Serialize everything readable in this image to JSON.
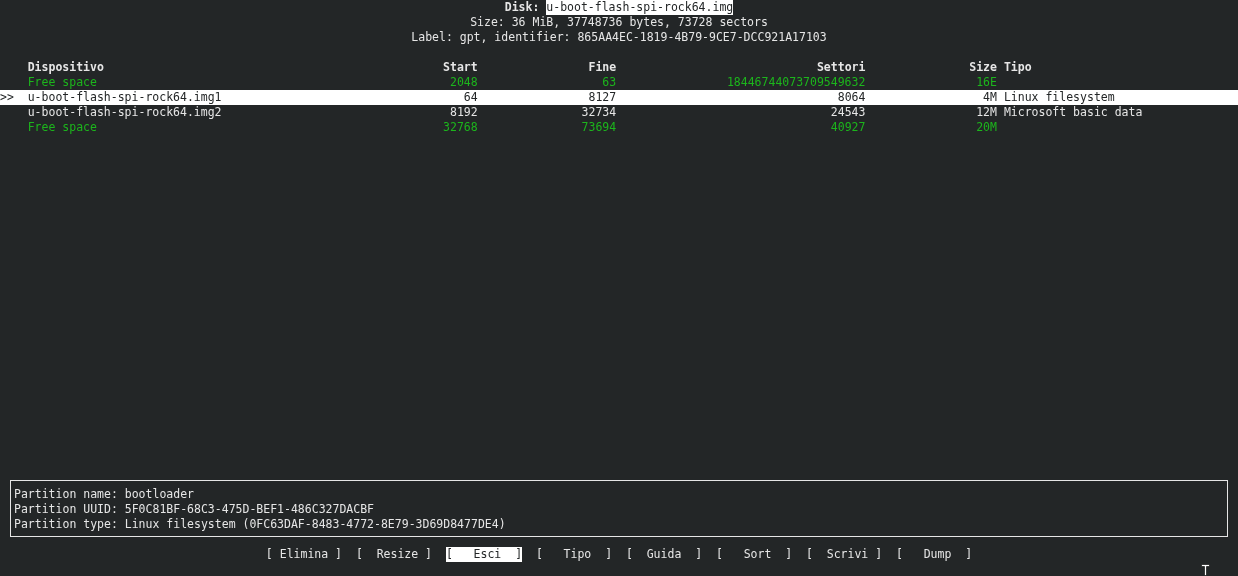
{
  "header": {
    "disk_label": "Disk:",
    "disk_name": "u-boot-flash-spi-rock64.img",
    "size_line": "Size: 36 MiB, 37748736 bytes, 73728 sectors",
    "label_line": "Label: gpt, identifier: 865AA4EC-1819-4B79-9CE7-DCC921A17103"
  },
  "table": {
    "cursor": ">>",
    "columns": [
      "Dispositivo",
      "Start",
      "Fine",
      "Settori",
      "Size",
      "Tipo"
    ],
    "rows": [
      {
        "kind": "free",
        "selected": false,
        "device": "Free space",
        "start": "2048",
        "end": "63",
        "sectors": "18446744073709549632",
        "size": "16E"
      },
      {
        "kind": "partition",
        "selected": true,
        "device": "u-boot-flash-spi-rock64.img1",
        "start": "64",
        "end": "8127",
        "sectors": "8064",
        "size": "4M",
        "type": "Linux filesystem"
      },
      {
        "kind": "partition",
        "selected": false,
        "device": "u-boot-flash-spi-rock64.img2",
        "start": "8192",
        "end": "32734",
        "sectors": "24543",
        "size": "12M",
        "type": "Microsoft basic data"
      },
      {
        "kind": "free",
        "selected": false,
        "device": "Free space",
        "start": "32768",
        "end": "73694",
        "sectors": "40927",
        "size": "20M"
      }
    ]
  },
  "info": [
    "Partition name: bootloader",
    "Partition UUID: 5F0C81BF-68C3-475D-BEF1-486C327DACBF",
    "Partition type: Linux filesystem (0FC63DAF-8483-4772-8E79-3D69D8477DE4)"
  ],
  "buttons": [
    {
      "text": "[ Elimina ]",
      "selected": false
    },
    {
      "text": "[  Resize ]",
      "selected": false
    },
    {
      "text": "[   Esci  ]",
      "selected": true
    },
    {
      "text": "[   Tipo  ]",
      "selected": false
    },
    {
      "text": "[  Guida  ]",
      "selected": false
    },
    {
      "text": "[   Sort  ]",
      "selected": false
    },
    {
      "text": "[  Scrivi ]",
      "selected": false
    },
    {
      "text": "[   Dump  ]",
      "selected": false
    }
  ]
}
